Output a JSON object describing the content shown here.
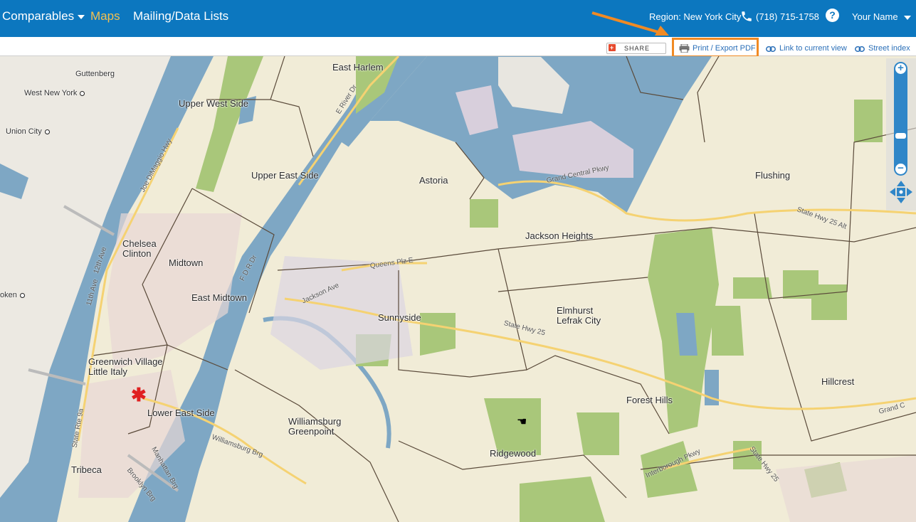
{
  "nav": {
    "comparables": "Comparables",
    "maps": "Maps",
    "mailing": "Mailing/Data Lists",
    "region": "Region: New York City",
    "phone": "(718) 715-1758",
    "help": "?",
    "user": "Your Name"
  },
  "toolbar": {
    "share": "SHARE",
    "print": "Print / Export PDF",
    "link": "Link to current view",
    "street_index": "Street index"
  },
  "map": {
    "places": {
      "guttenberg": "Guttenberg",
      "west_new_york": "West New York",
      "union_city": "Union City",
      "hoboken": "oken",
      "upper_west_side": "Upper West Side",
      "upper_east_side": "Upper East Side",
      "east_harlem": "East Harlem",
      "chelsea": "Chelsea",
      "clinton": "Clinton",
      "midtown": "Midtown",
      "east_midtown": "East Midtown",
      "greenwich": "Greenwich Village",
      "little_italy": "Little Italy",
      "lower_east_side": "Lower East Side",
      "tribeca": "Tribeca",
      "astoria": "Astoria",
      "jackson_heights": "Jackson Heights",
      "sunnyside": "Sunnyside",
      "elmhurst": "Elmhurst",
      "lefrak": "Lefrak City",
      "flushing": "Flushing",
      "williamsburg": "Williamsburg",
      "greenpoint": "Greenpoint",
      "ridgewood": "Ridgewood",
      "forest_hills": "Forest Hills",
      "hillcrest": "Hillcrest"
    },
    "roads": {
      "joe_dimaggio": "Joe DiMaggio Hwy",
      "twelfth_ave": "12th Ave",
      "eleventh_ave": "11th Ave",
      "state_rte_9a": "State Rte 9a",
      "fdr": "F D R Dr",
      "e_river": "E River Dr",
      "queens_plz": "Queens Plz E",
      "jackson_ave": "Jackson Ave",
      "grand_central": "Grand Central Pkwy",
      "hwy25": "State Hwy 25",
      "hwy25alt": "State Hwy 25 Alt",
      "williamsburg_brg": "Williamsburg Brg",
      "manhattan_brg": "Manhattan Brg",
      "brooklyn_brg": "Brooklyn Brg",
      "interborough": "Interborough Pkwy",
      "grand_c": "Grand C",
      "hwy25b": "State Hwy 25"
    }
  }
}
